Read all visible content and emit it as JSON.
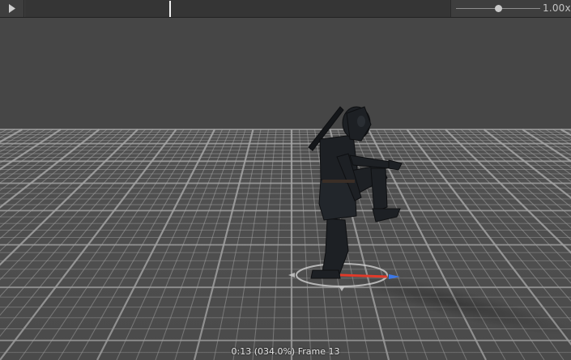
{
  "toolbar": {
    "play_icon": "play-icon",
    "timeline_progress": 0.34,
    "playback_speed_label": "1.00x",
    "playback_speed_slider": 0.5
  },
  "viewport": {
    "frame_readout": "0:13 (034.0%) Frame 13"
  },
  "colors": {
    "toolbar_bg": "#3e3e3e",
    "timeline_bg": "#353535",
    "playhead": "#f2f2f2",
    "background": "#464646",
    "grid_floor": "#5a5a5a",
    "axis_red": "#e03a2a",
    "axis_blue": "#3c78e8"
  }
}
